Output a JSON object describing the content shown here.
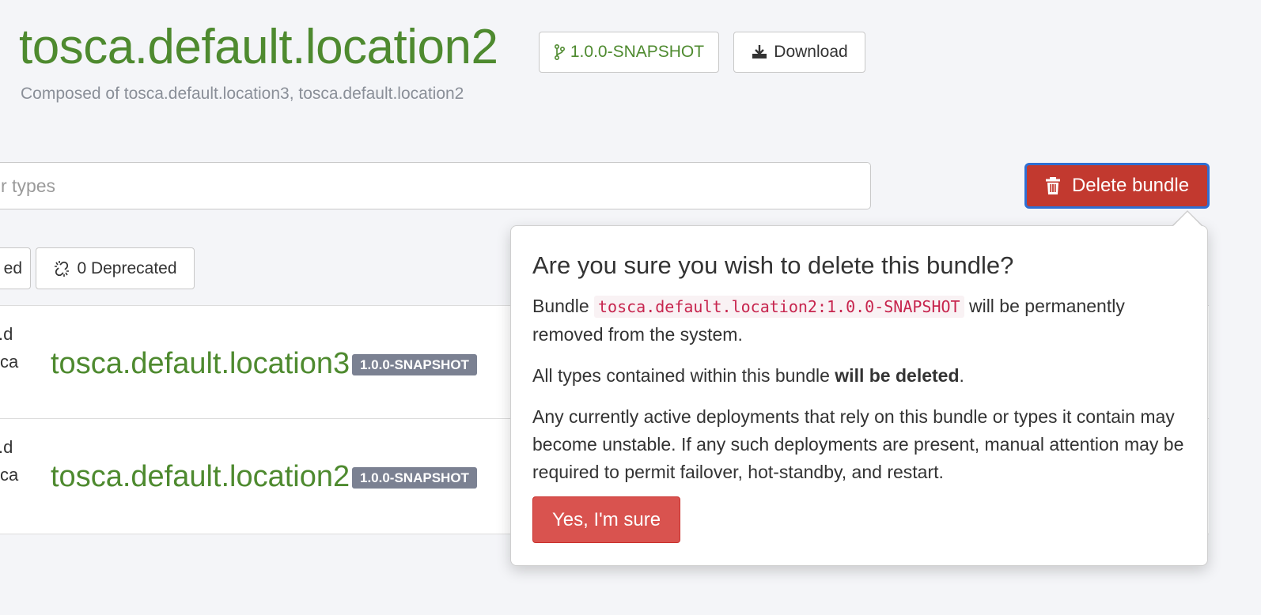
{
  "header": {
    "title": "tosca.default.location2",
    "version_label": "1.0.0-SNAPSHOT",
    "download_label": "Download",
    "subtitle": "Composed of tosca.default.location3, tosca.default.location2"
  },
  "filter": {
    "placeholder": "r types",
    "value": ""
  },
  "actions": {
    "delete_label": "Delete bundle"
  },
  "pills": {
    "previous_fragment": "ed",
    "deprecated_label": "0 Deprecated"
  },
  "rows": [
    {
      "fragment_top": ".d",
      "fragment_bottom": "ca",
      "name": "tosca.default.location3",
      "badge": "1.0.0-SNAPSHOT"
    },
    {
      "fragment_top": ".d",
      "fragment_bottom": "ca",
      "name": "tosca.default.location2",
      "badge": "1.0.0-SNAPSHOT"
    }
  ],
  "popover": {
    "title": "Are you sure you wish to delete this bundle?",
    "p1_before": "Bundle ",
    "p1_code": "tosca.default.location2:1.0.0-SNAPSHOT",
    "p1_after": " will be permanently removed from the system.",
    "p2_before": "All types contained within this bundle ",
    "p2_bold": "will be deleted",
    "p2_after": ".",
    "p3": "Any currently active deployments that rely on this bundle or types it contain may become unstable. If any such deployments are present, manual attention may be required to permit failover, hot-standby, and restart.",
    "confirm_label": "Yes, I'm sure"
  },
  "colors": {
    "brand_green": "#4e8a2f",
    "danger": "#c2392f",
    "danger_light": "#d9534f",
    "focus_ring": "#2f6fd3",
    "badge_gray": "#7b8192"
  },
  "icons": {
    "version": "git-branch-icon",
    "download": "download-icon",
    "delete": "trash-icon",
    "deprecated": "broken-link-icon"
  }
}
